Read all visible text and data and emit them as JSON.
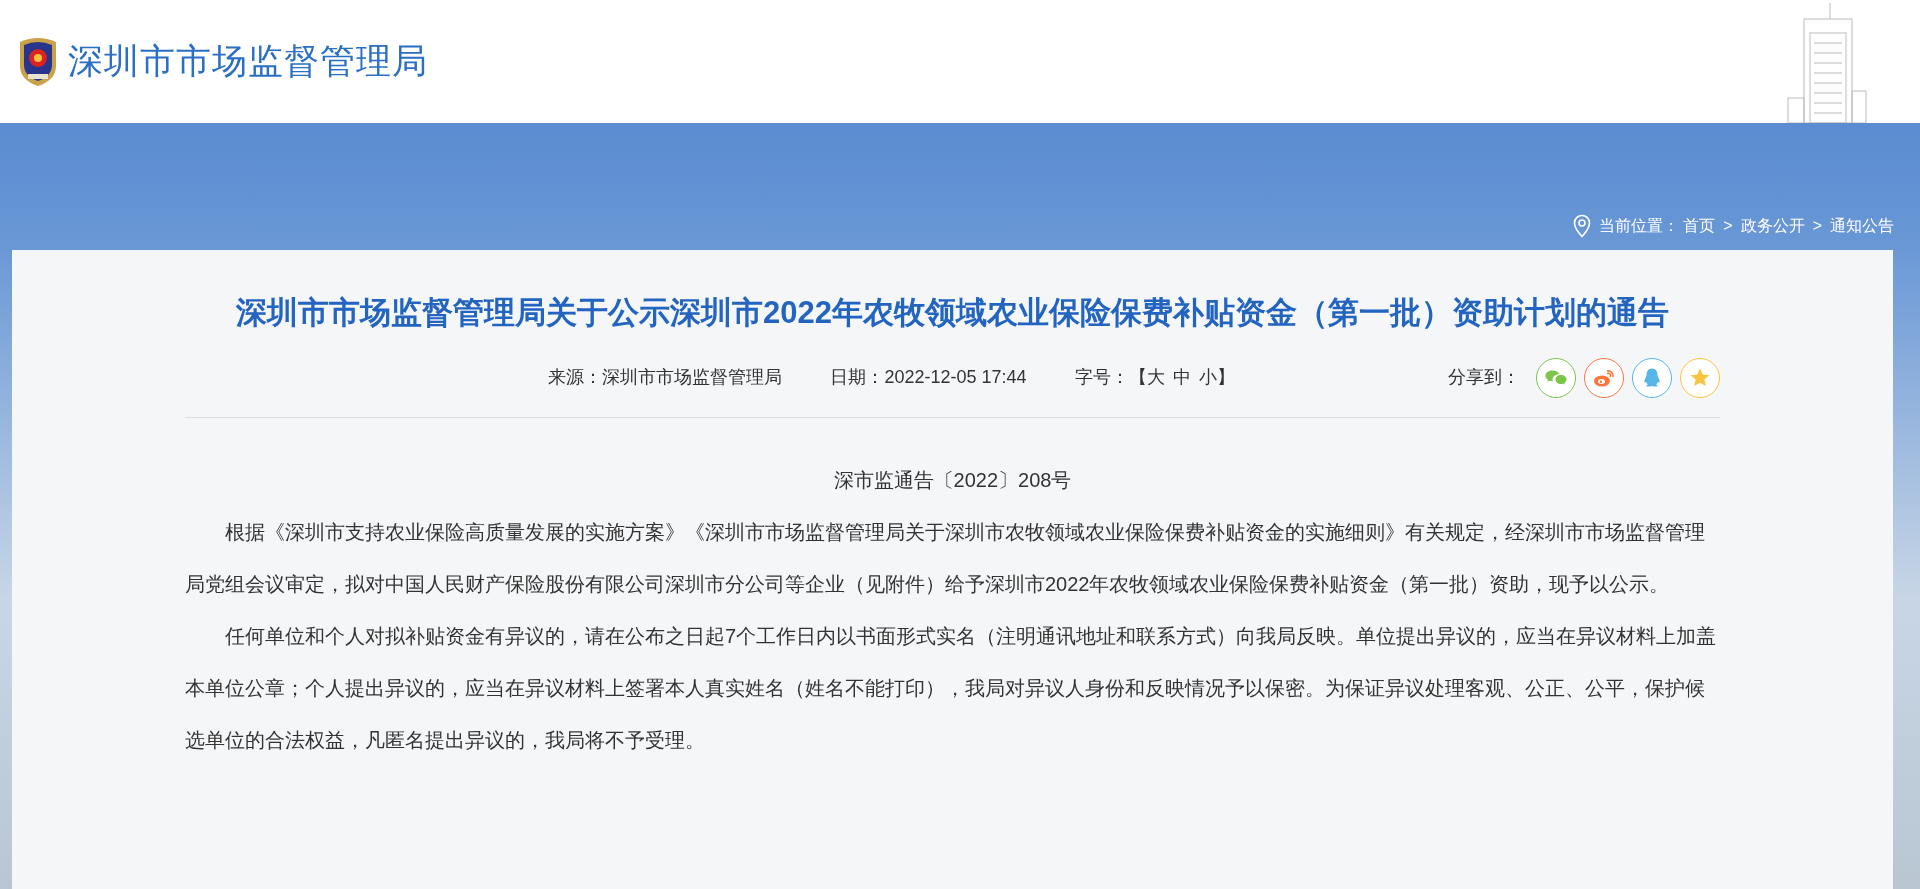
{
  "header": {
    "site_title": "深圳市市场监督管理局"
  },
  "breadcrumb": {
    "label": "当前位置：",
    "separator": ">",
    "items": [
      "首页",
      "政务公开",
      "通知公告"
    ]
  },
  "article": {
    "title": "深圳市市场监督管理局关于公示深圳市2022年农牧领域农业保险保费补贴资金（第一批）资助计划的通告",
    "meta": {
      "source_label": "来源：",
      "source": "深圳市市场监督管理局",
      "date_label": "日期：",
      "date": "2022-12-05 17:44",
      "font_size_label": "字号：",
      "bracket_open": "【",
      "bracket_close": "】",
      "font_sizes": [
        "大",
        "中",
        "小"
      ]
    },
    "share": {
      "label": "分享到：",
      "buttons": [
        {
          "kind": "wechat",
          "color": "#7bc549"
        },
        {
          "kind": "weibo",
          "color": "#ff763b"
        },
        {
          "kind": "qq",
          "color": "#56b6e7"
        },
        {
          "kind": "favorite",
          "color": "#fbc441"
        }
      ]
    },
    "doc_number": "深市监通告〔2022〕208号",
    "paragraphs": [
      "根据《深圳市支持农业保险高质量发展的实施方案》《深圳市市场监督管理局关于深圳市农牧领域农业保险保费补贴资金的实施细则》有关规定，经深圳市市场监督管理局党组会议审定，拟对中国人民财产保险股份有限公司深圳市分公司等企业（见附件）给予深圳市2022年农牧领域农业保险保费补贴资金（第一批）资助，现予以公示。",
      "任何单位和个人对拟补贴资金有异议的，请在公布之日起7个工作日内以书面形式实名（注明通讯地址和联系方式）向我局反映。单位提出异议的，应当在异议材料上加盖本单位公章；个人提出异议的，应当在异议材料上签署本人真实姓名（姓名不能打印），我局对异议人身份和反映情况予以保密。为保证异议处理客观、公正、公平，保护候选单位的合法权益，凡匿名提出异议的，我局将不予受理。"
    ]
  }
}
